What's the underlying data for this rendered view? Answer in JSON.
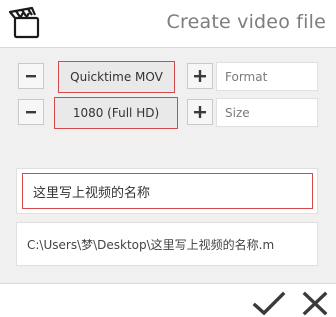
{
  "header": {
    "title": "Create video file",
    "logo_icon": "clapperboard-icon"
  },
  "format_row": {
    "decrement_icon": "minus-icon",
    "value": "Quicktime MOV",
    "increment_icon": "plus-icon",
    "label": "Format"
  },
  "size_row": {
    "decrement_icon": "minus-icon",
    "value": "1080 (Full HD)",
    "increment_icon": "plus-icon",
    "label": "Size"
  },
  "name_field": {
    "value": "这里写上视频的名称"
  },
  "path_field": {
    "value": "C:\\Users\\梦\\Desktop\\这里写上视频的名称.m"
  },
  "footer": {
    "confirm_icon": "checkmark-icon",
    "cancel_icon": "close-icon"
  },
  "colors": {
    "accent_border": "#d24a4a",
    "title_text": "#7d7d7d",
    "icon": "#3a3a3a"
  }
}
